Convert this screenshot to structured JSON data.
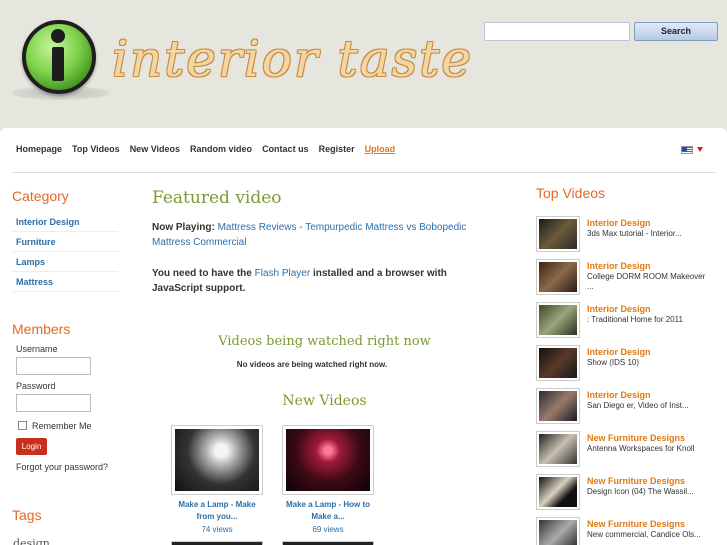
{
  "header": {
    "logo_text": "interior taste",
    "search_placeholder": "",
    "search_button": "Search"
  },
  "nav": {
    "items": [
      "Homepage",
      "Top Videos",
      "New Videos",
      "Random video",
      "Contact us",
      "Register",
      "Upload"
    ],
    "language_flag": "us-flag-icon"
  },
  "category": {
    "title": "Category",
    "items": [
      "Interior Design",
      "Furniture",
      "Lamps",
      "Mattress"
    ]
  },
  "members": {
    "title": "Members",
    "username_label": "Username",
    "password_label": "Password",
    "remember_label": "Remember Me",
    "login_button": "Login",
    "forgot_link": "Forgot your password?"
  },
  "tags": {
    "title": "Tags",
    "first_tag": "design"
  },
  "featured": {
    "title": "Featured video",
    "now_playing_label": "Now Playing:",
    "now_playing_value": "Mattress Reviews - Tempurpedic Mattress vs Bobopedic Mattress Commercial",
    "flash_prefix": "You need to have the",
    "flash_link": "Flash Player",
    "flash_suffix": "installed and a browser with JavaScript support."
  },
  "watching": {
    "title": "Videos being watched right now",
    "empty_note": "No videos are being watched right now."
  },
  "new_videos": {
    "title": "New Videos",
    "items": [
      {
        "title": "Make a Lamp - Make from you...",
        "views": "74 views"
      },
      {
        "title": "Make a Lamp - How to Make a...",
        "views": "69 views"
      }
    ]
  },
  "top_videos": {
    "title": "Top Videos",
    "items": [
      {
        "category": "Interior Design",
        "desc": "3ds Max tutorial - Interior..."
      },
      {
        "category": "Interior Design",
        "desc": "College DORM ROOM Makeover ..."
      },
      {
        "category": "Interior Design",
        "desc": ": Traditional Home for 2011"
      },
      {
        "category": "Interior Design",
        "desc": "Show (IDS 10)"
      },
      {
        "category": "Interior Design",
        "desc": "San Diego er, Video of Inst..."
      },
      {
        "category": "New Furniture Designs",
        "desc": "Antenna Workspaces for Knoll"
      },
      {
        "category": "New Furniture Designs",
        "desc": "Design Icon (04) The Wassil..."
      },
      {
        "category": "New Furniture Designs",
        "desc": "New commercial, Candice Ols..."
      }
    ]
  },
  "colors": {
    "accent_orange": "#e46a2a",
    "link_blue": "#2d6fa8",
    "heading_green": "#7a9a32",
    "login_red": "#c8301c"
  }
}
